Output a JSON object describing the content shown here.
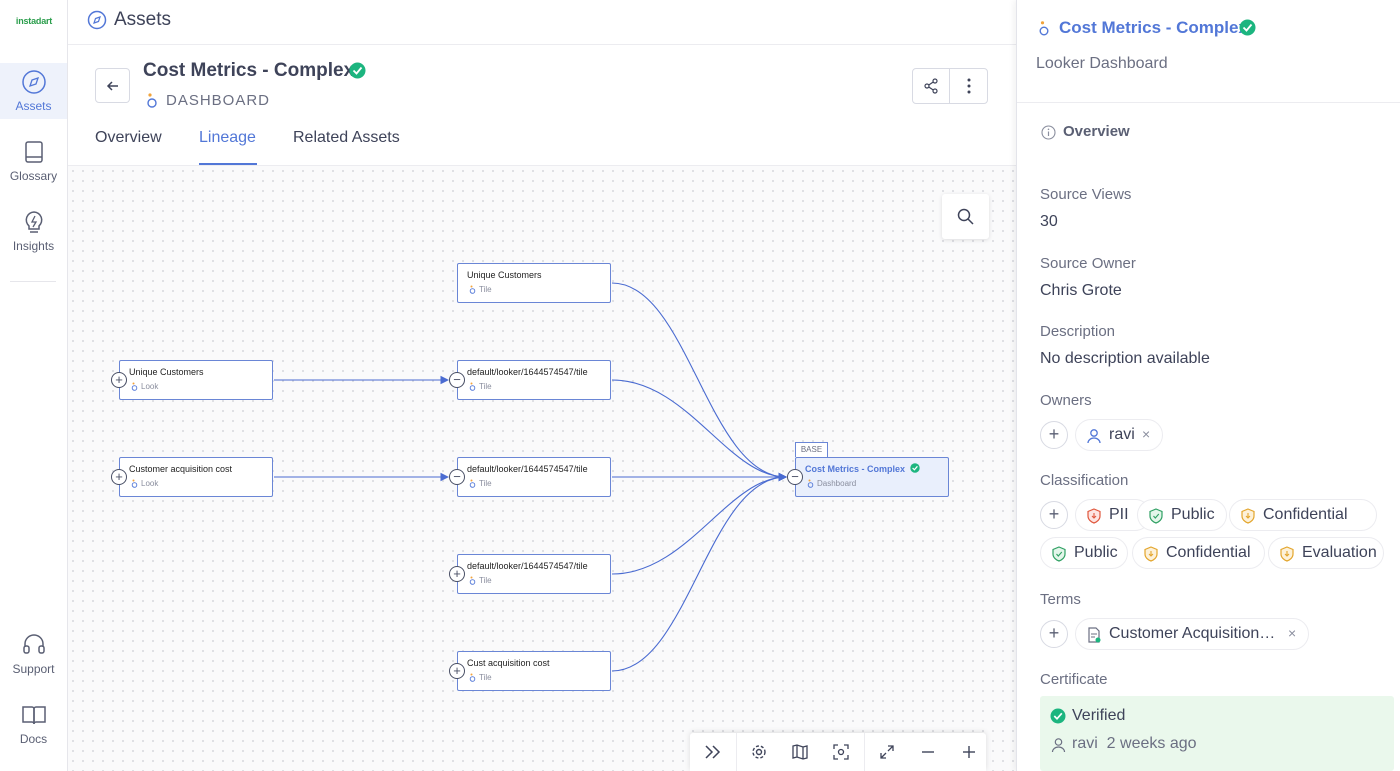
{
  "brand": {
    "logo_text": "instadart",
    "accent": "#5277d7",
    "verified_color": "#1cb57f"
  },
  "nav": {
    "items": [
      {
        "label": "Assets",
        "icon": "compass-icon",
        "active": true
      },
      {
        "label": "Glossary",
        "icon": "book-icon"
      },
      {
        "label": "Insights",
        "icon": "bulb-icon"
      }
    ],
    "bottom": [
      {
        "label": "Support",
        "icon": "headset-icon"
      },
      {
        "label": "Docs",
        "icon": "open-book-icon"
      }
    ]
  },
  "topbar": {
    "title": "Assets",
    "icon": "compass-icon"
  },
  "asset": {
    "title": "Cost Metrics - Complex",
    "type": "DASHBOARD",
    "tabs": [
      "Overview",
      "Lineage",
      "Related Assets"
    ],
    "active_tab": "Lineage"
  },
  "lineage": {
    "nodes": [
      {
        "title": "Unique Customers",
        "type": "Tile"
      },
      {
        "title": "Unique Customers",
        "type": "Look"
      },
      {
        "title": "default/looker/1644574547/tile",
        "type": "Tile"
      },
      {
        "title": "Customer acquisition cost",
        "type": "Look"
      },
      {
        "title": "default/looker/1644574547/tile",
        "type": "Tile"
      },
      {
        "title": "default/looker/1644574547/tile",
        "type": "Tile"
      },
      {
        "title": "Cust acquisition cost",
        "type": "Tile"
      },
      {
        "title": "Cost Metrics - Complex",
        "type": "Dashboard",
        "base": true
      }
    ],
    "base_tag": "BASE"
  },
  "panel": {
    "title": "Cost Metrics - Complex",
    "subtitle": "Looker Dashboard",
    "overview_label": "Overview",
    "source_views_label": "Source Views",
    "source_views": "30",
    "source_owner_label": "Source Owner",
    "source_owner": "Chris Grote",
    "description_label": "Description",
    "description": "No description available",
    "owners_label": "Owners",
    "owners": [
      "ravi"
    ],
    "classification_label": "Classification",
    "classifications": [
      "PII",
      "Public",
      "Confidential",
      "Public",
      "Confidential",
      "Evaluation"
    ],
    "terms_label": "Terms",
    "terms": [
      "Customer Acquisition…"
    ],
    "certificate_label": "Certificate",
    "certificate_status": "Verified",
    "certificate_by": "ravi",
    "certificate_when": "2 weeks ago"
  }
}
